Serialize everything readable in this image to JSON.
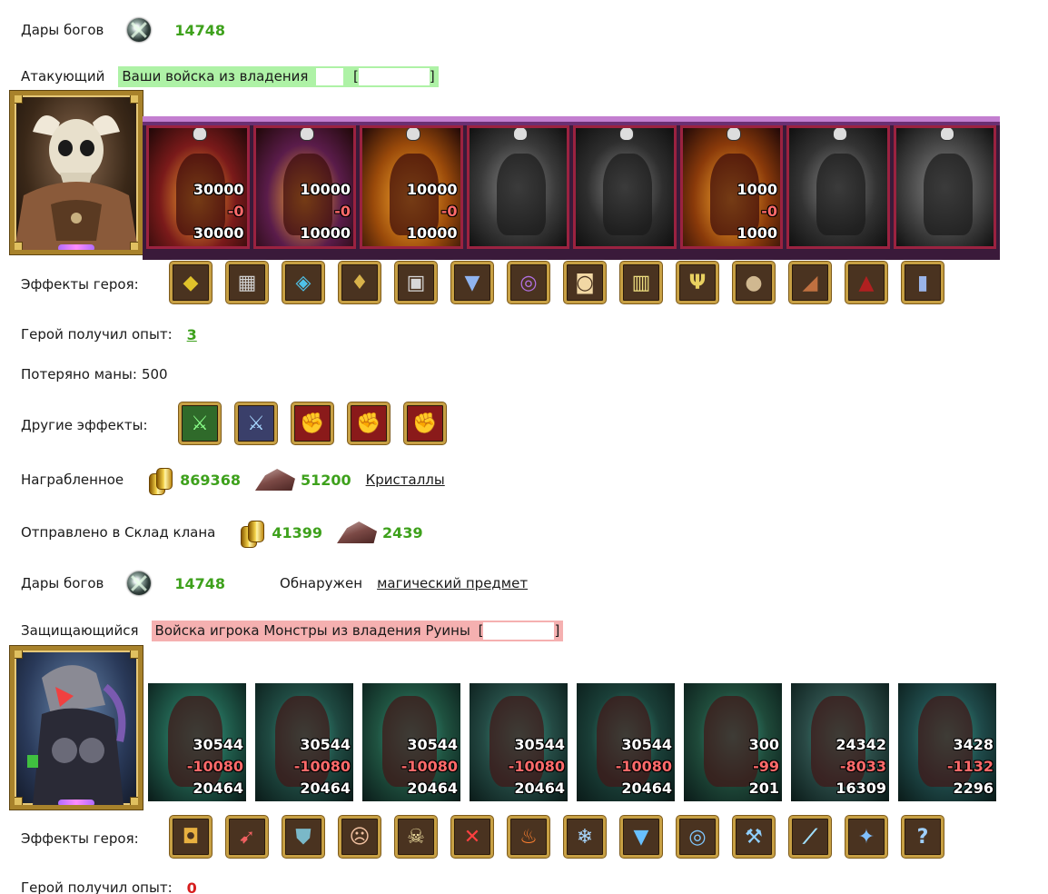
{
  "gifts_top": {
    "label": "Дары богов",
    "value": "14748",
    "icon": "god-gift-icon"
  },
  "attacker": {
    "label": "Атакующий",
    "banner": "Ваши войска из владения",
    "bracket_open": "[",
    "bracket_close": "]"
  },
  "attacker_units": [
    {
      "icon": "red-dragon-unit-icon",
      "start": "30000",
      "lost": "-0",
      "end": "30000",
      "active": true,
      "color": "#7a1a1a"
    },
    {
      "icon": "bone-dragon-unit-icon",
      "start": "10000",
      "lost": "-0",
      "end": "10000",
      "active": true,
      "color": "#5a1c4a"
    },
    {
      "icon": "fire-beast-unit-icon",
      "start": "10000",
      "lost": "-0",
      "end": "10000",
      "active": true,
      "color": "#9a4a0a"
    },
    {
      "icon": "gargoyle-unit-icon",
      "start": "",
      "lost": "",
      "end": "",
      "active": false,
      "color": "#3a3a3a"
    },
    {
      "icon": "golem-unit-icon",
      "start": "",
      "lost": "",
      "end": "",
      "active": false,
      "color": "#2e2e2e"
    },
    {
      "icon": "fire-warrior-unit-icon",
      "start": "1000",
      "lost": "-0",
      "end": "1000",
      "active": true,
      "color": "#8a3a0a"
    },
    {
      "icon": "dark-knight-unit-icon",
      "start": "",
      "lost": "",
      "end": "",
      "active": false,
      "color": "#333333"
    },
    {
      "icon": "reaper-unit-icon",
      "start": "",
      "lost": "",
      "end": "",
      "active": false,
      "color": "#444444"
    }
  ],
  "attacker_hero_effects": {
    "label": "Эффекты героя:",
    "icons": [
      {
        "name": "gold-chest-icon",
        "glyph": "◆",
        "color": "#e0c22a"
      },
      {
        "name": "armor-grid-icon",
        "glyph": "▦",
        "color": "#cfcfcf"
      },
      {
        "name": "crystal-cube-icon",
        "glyph": "◈",
        "color": "#4fc2e8"
      },
      {
        "name": "amulet-icon",
        "glyph": "♦",
        "color": "#d8b24a"
      },
      {
        "name": "helmet-icon",
        "glyph": "▣",
        "color": "#d8d8d8"
      },
      {
        "name": "cuirass-icon",
        "glyph": "▼",
        "color": "#8fb4f0"
      },
      {
        "name": "ring-purple-icon",
        "glyph": "◎",
        "color": "#b070e0"
      },
      {
        "name": "scroll-icon",
        "glyph": "◙",
        "color": "#f2d8a4"
      },
      {
        "name": "tankard-icon",
        "glyph": "▥",
        "color": "#f0e080"
      },
      {
        "name": "trident-icon",
        "glyph": "Ψ",
        "color": "#e8d060"
      },
      {
        "name": "shield-round-icon",
        "glyph": "●",
        "color": "#d0b890"
      },
      {
        "name": "bracer-icon",
        "glyph": "◢",
        "color": "#c07040"
      },
      {
        "name": "cloak-icon",
        "glyph": "▲",
        "color": "#b02020"
      },
      {
        "name": "boots-icon",
        "glyph": "▮",
        "color": "#9ab4e8"
      }
    ]
  },
  "attacker_exp": {
    "label": "Герой получил опыт:",
    "value": "3"
  },
  "mana_lost": {
    "label": "Потеряно маны:",
    "value": "500"
  },
  "other_effects": {
    "label": "Другие эффекты:",
    "icons": [
      {
        "name": "sword-green-icon",
        "glyph": "⚔",
        "color": "#8aff8a",
        "bg": "#2f6a2a"
      },
      {
        "name": "sword-blue-icon",
        "glyph": "⚔",
        "color": "#a8d8ff",
        "bg": "#3a3f6a"
      },
      {
        "name": "fist-sword-icon",
        "glyph": "✊",
        "color": "#ffd0a0",
        "bg": "#8a1a1a"
      },
      {
        "name": "fist-sword-icon-2",
        "glyph": "✊",
        "color": "#ffd0a0",
        "bg": "#8a1a1a"
      },
      {
        "name": "fist-sword-icon-3",
        "glyph": "✊",
        "color": "#ffd0a0",
        "bg": "#8a1a1a"
      }
    ]
  },
  "loot": {
    "label": "Награбленное",
    "gold": "869368",
    "ore": "51200",
    "link": "Кристаллы"
  },
  "clan_storage": {
    "label": "Отправлено в Склад клана",
    "gold": "41399",
    "ore": "2439"
  },
  "gifts_bottom": {
    "label": "Дары богов",
    "value": "14748",
    "found_label": "Обнаружен",
    "found_link": "магический предмет"
  },
  "defender": {
    "label": "Защищающийся",
    "banner": "Войска игрока Монстры из владения Руины",
    "bracket_open": "[",
    "bracket_close": "]"
  },
  "defender_units": [
    {
      "icon": "lizard-warrior-unit-icon",
      "start": "30544",
      "lost": "-10080",
      "end": "20464",
      "color": "#1f5a4a"
    },
    {
      "icon": "stone-golem-unit-icon",
      "start": "30544",
      "lost": "-10080",
      "end": "20464",
      "color": "#1f4a42"
    },
    {
      "icon": "orc-shaman-unit-icon",
      "start": "30544",
      "lost": "-10080",
      "end": "20464",
      "color": "#1f5240"
    },
    {
      "icon": "red-demon-unit-icon",
      "start": "30544",
      "lost": "-10080",
      "end": "20464",
      "color": "#244a44"
    },
    {
      "icon": "spider-beast-unit-icon",
      "start": "30544",
      "lost": "-10080",
      "end": "20464",
      "color": "#1a3f38"
    },
    {
      "icon": "red-fiend-unit-icon",
      "start": "300",
      "lost": "-99",
      "end": "201",
      "color": "#1f4a3a"
    },
    {
      "icon": "tower-beast-unit-icon",
      "start": "24342",
      "lost": "-8033",
      "end": "16309",
      "color": "#2a4a46"
    },
    {
      "icon": "naga-witch-unit-icon",
      "start": "3428",
      "lost": "-1132",
      "end": "2296",
      "color": "#1f4a4a"
    }
  ],
  "defender_hero_effects": {
    "label": "Эффекты героя:",
    "icons": [
      {
        "name": "lantern-icon",
        "glyph": "◘",
        "color": "#e8b040"
      },
      {
        "name": "arrow-fire-icon",
        "glyph": "➹",
        "color": "#f06060"
      },
      {
        "name": "shield-blue-icon",
        "glyph": "⛊",
        "color": "#7ab8c8"
      },
      {
        "name": "scream-face-icon",
        "glyph": "☹",
        "color": "#f0c0a0"
      },
      {
        "name": "skeleton-gold-icon",
        "glyph": "☠",
        "color": "#f0e0a0"
      },
      {
        "name": "crossed-axes-icon",
        "glyph": "✕",
        "color": "#ff4040"
      },
      {
        "name": "fire-head-icon",
        "glyph": "♨",
        "color": "#ff8030"
      },
      {
        "name": "ice-crystal-icon",
        "glyph": "❄",
        "color": "#a8d8ff"
      },
      {
        "name": "ice-armor-icon",
        "glyph": "▼",
        "color": "#68c0ff"
      },
      {
        "name": "ice-ring-icon",
        "glyph": "◎",
        "color": "#80c8ff"
      },
      {
        "name": "ice-axe-icon",
        "glyph": "⚒",
        "color": "#90d0ff"
      },
      {
        "name": "ice-staff-icon",
        "glyph": "⟋",
        "color": "#a0e0ff"
      },
      {
        "name": "ice-shard-icon",
        "glyph": "✦",
        "color": "#80c0ff"
      },
      {
        "name": "question-icon",
        "glyph": "?",
        "color": "#a0d0ff"
      }
    ]
  },
  "defender_exp": {
    "label": "Герой получил опыт:",
    "value": "0"
  }
}
